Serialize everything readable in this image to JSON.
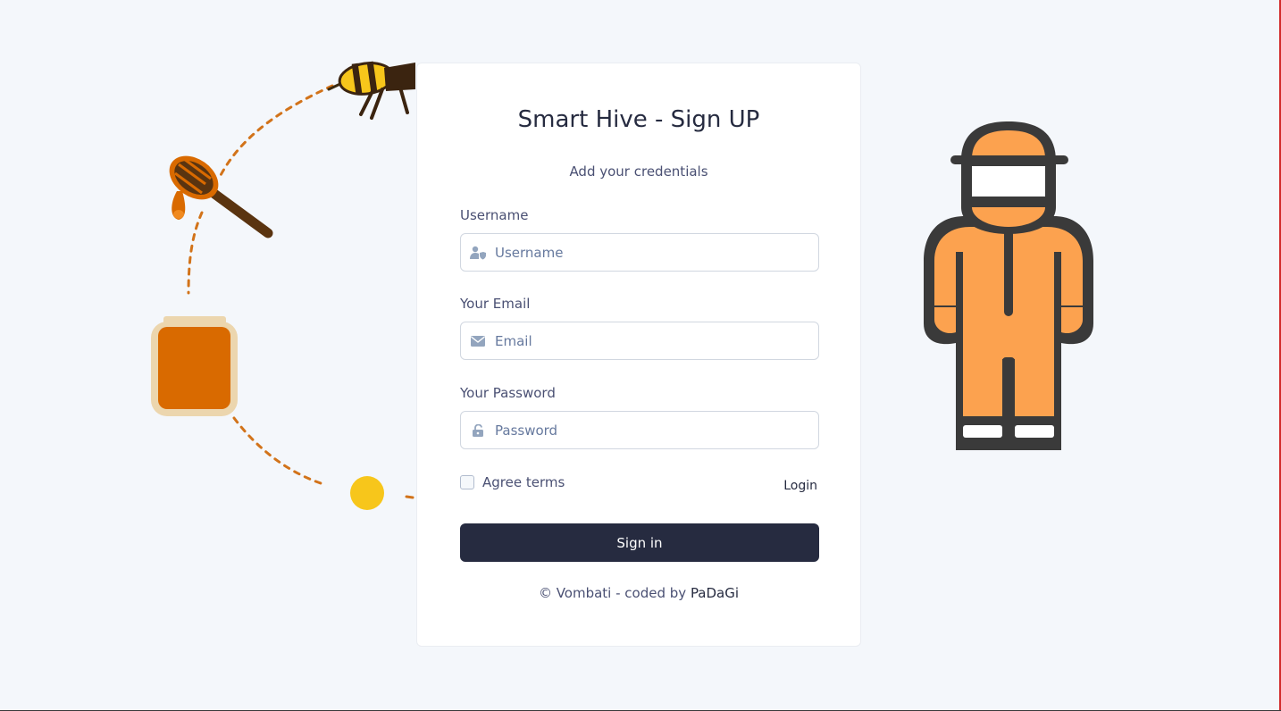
{
  "form": {
    "title": "Smart Hive - Sign UP",
    "subtitle": "Add your credentials",
    "username": {
      "label": "Username",
      "placeholder": "Username",
      "value": "",
      "icon": "user-shield-icon"
    },
    "email": {
      "label": "Your Email",
      "placeholder": "Email",
      "value": "",
      "icon": "envelope-icon"
    },
    "password": {
      "label": "Your Password",
      "placeholder": "Password",
      "value": "",
      "icon": "unlock-icon"
    },
    "agree_label": "Agree terms",
    "agree_checked": false,
    "login_link": "Login",
    "submit_label": "Sign in"
  },
  "footer": {
    "copyright": "© Vombati - coded by ",
    "author": "PaDaGi"
  },
  "theme": {
    "primary": "#262b40",
    "background": "#f4f7fb",
    "honey": "#d96a00",
    "suit": "#fca24f",
    "bee_yellow": "#f7c61b"
  },
  "illustrations": {
    "left": [
      "bee-icon",
      "honey-dipper-icon",
      "honey-jar-icon",
      "pollen-dot"
    ],
    "right": "beekeeper-icon"
  }
}
